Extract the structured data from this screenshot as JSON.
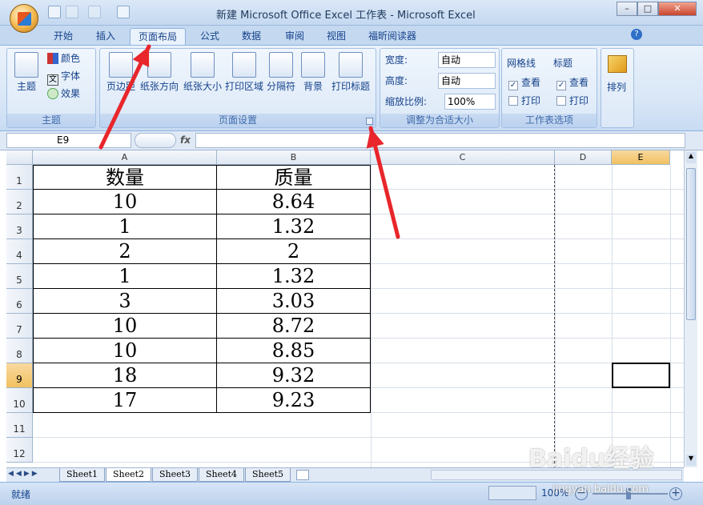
{
  "window": {
    "title": "新建 Microsoft Office Excel 工作表 - Microsoft Excel"
  },
  "tabs": [
    "开始",
    "插入",
    "页面布局",
    "公式",
    "数据",
    "审阅",
    "视图",
    "福昕阅读器"
  ],
  "active_tab": "页面布局",
  "ribbon": {
    "theme_group": {
      "label": "主题",
      "themes_btn": "主题",
      "colors": "颜色",
      "fonts": "字体",
      "effects": "效果"
    },
    "page_setup_group": {
      "label": "页面设置",
      "margins": "页边距",
      "orientation": "纸张方向",
      "size": "纸张大小",
      "print_area": "打印区域",
      "breaks": "分隔符",
      "background": "背景",
      "print_titles": "打印标题"
    },
    "scale_group": {
      "label": "调整为合适大小",
      "width_label": "宽度:",
      "width_value": "自动",
      "height_label": "高度:",
      "height_value": "自动",
      "scale_label": "缩放比例:",
      "scale_value": "100%"
    },
    "sheet_options_group": {
      "label": "工作表选项",
      "gridlines": "网格线",
      "headings": "标题",
      "view": "查看",
      "print": "打印"
    },
    "arrange_group": {
      "label": "排列"
    }
  },
  "formula_bar": {
    "name_box": "E9",
    "fx": "fx",
    "content": ""
  },
  "columns": [
    "A",
    "B",
    "C",
    "D",
    "E"
  ],
  "rows": [
    "1",
    "2",
    "3",
    "4",
    "5",
    "6",
    "7",
    "8",
    "9",
    "10",
    "11",
    "12"
  ],
  "table": {
    "headers": [
      "数量",
      "质量"
    ],
    "data": [
      [
        "10",
        "8.64"
      ],
      [
        "1",
        "1.32"
      ],
      [
        "2",
        "2"
      ],
      [
        "1",
        "1.32"
      ],
      [
        "3",
        "3.03"
      ],
      [
        "10",
        "8.72"
      ],
      [
        "10",
        "8.85"
      ],
      [
        "18",
        "9.32"
      ],
      [
        "17",
        "9.23"
      ]
    ]
  },
  "sheets": [
    "Sheet1",
    "Sheet2",
    "Sheet3",
    "Sheet4",
    "Sheet5"
  ],
  "active_sheet": "Sheet2",
  "status": {
    "ready": "就绪",
    "zoom": "100%"
  },
  "watermark": {
    "brand": "Baidu经验",
    "url": "jingyan.baidu.com"
  },
  "annotation_color": "#e8262b"
}
